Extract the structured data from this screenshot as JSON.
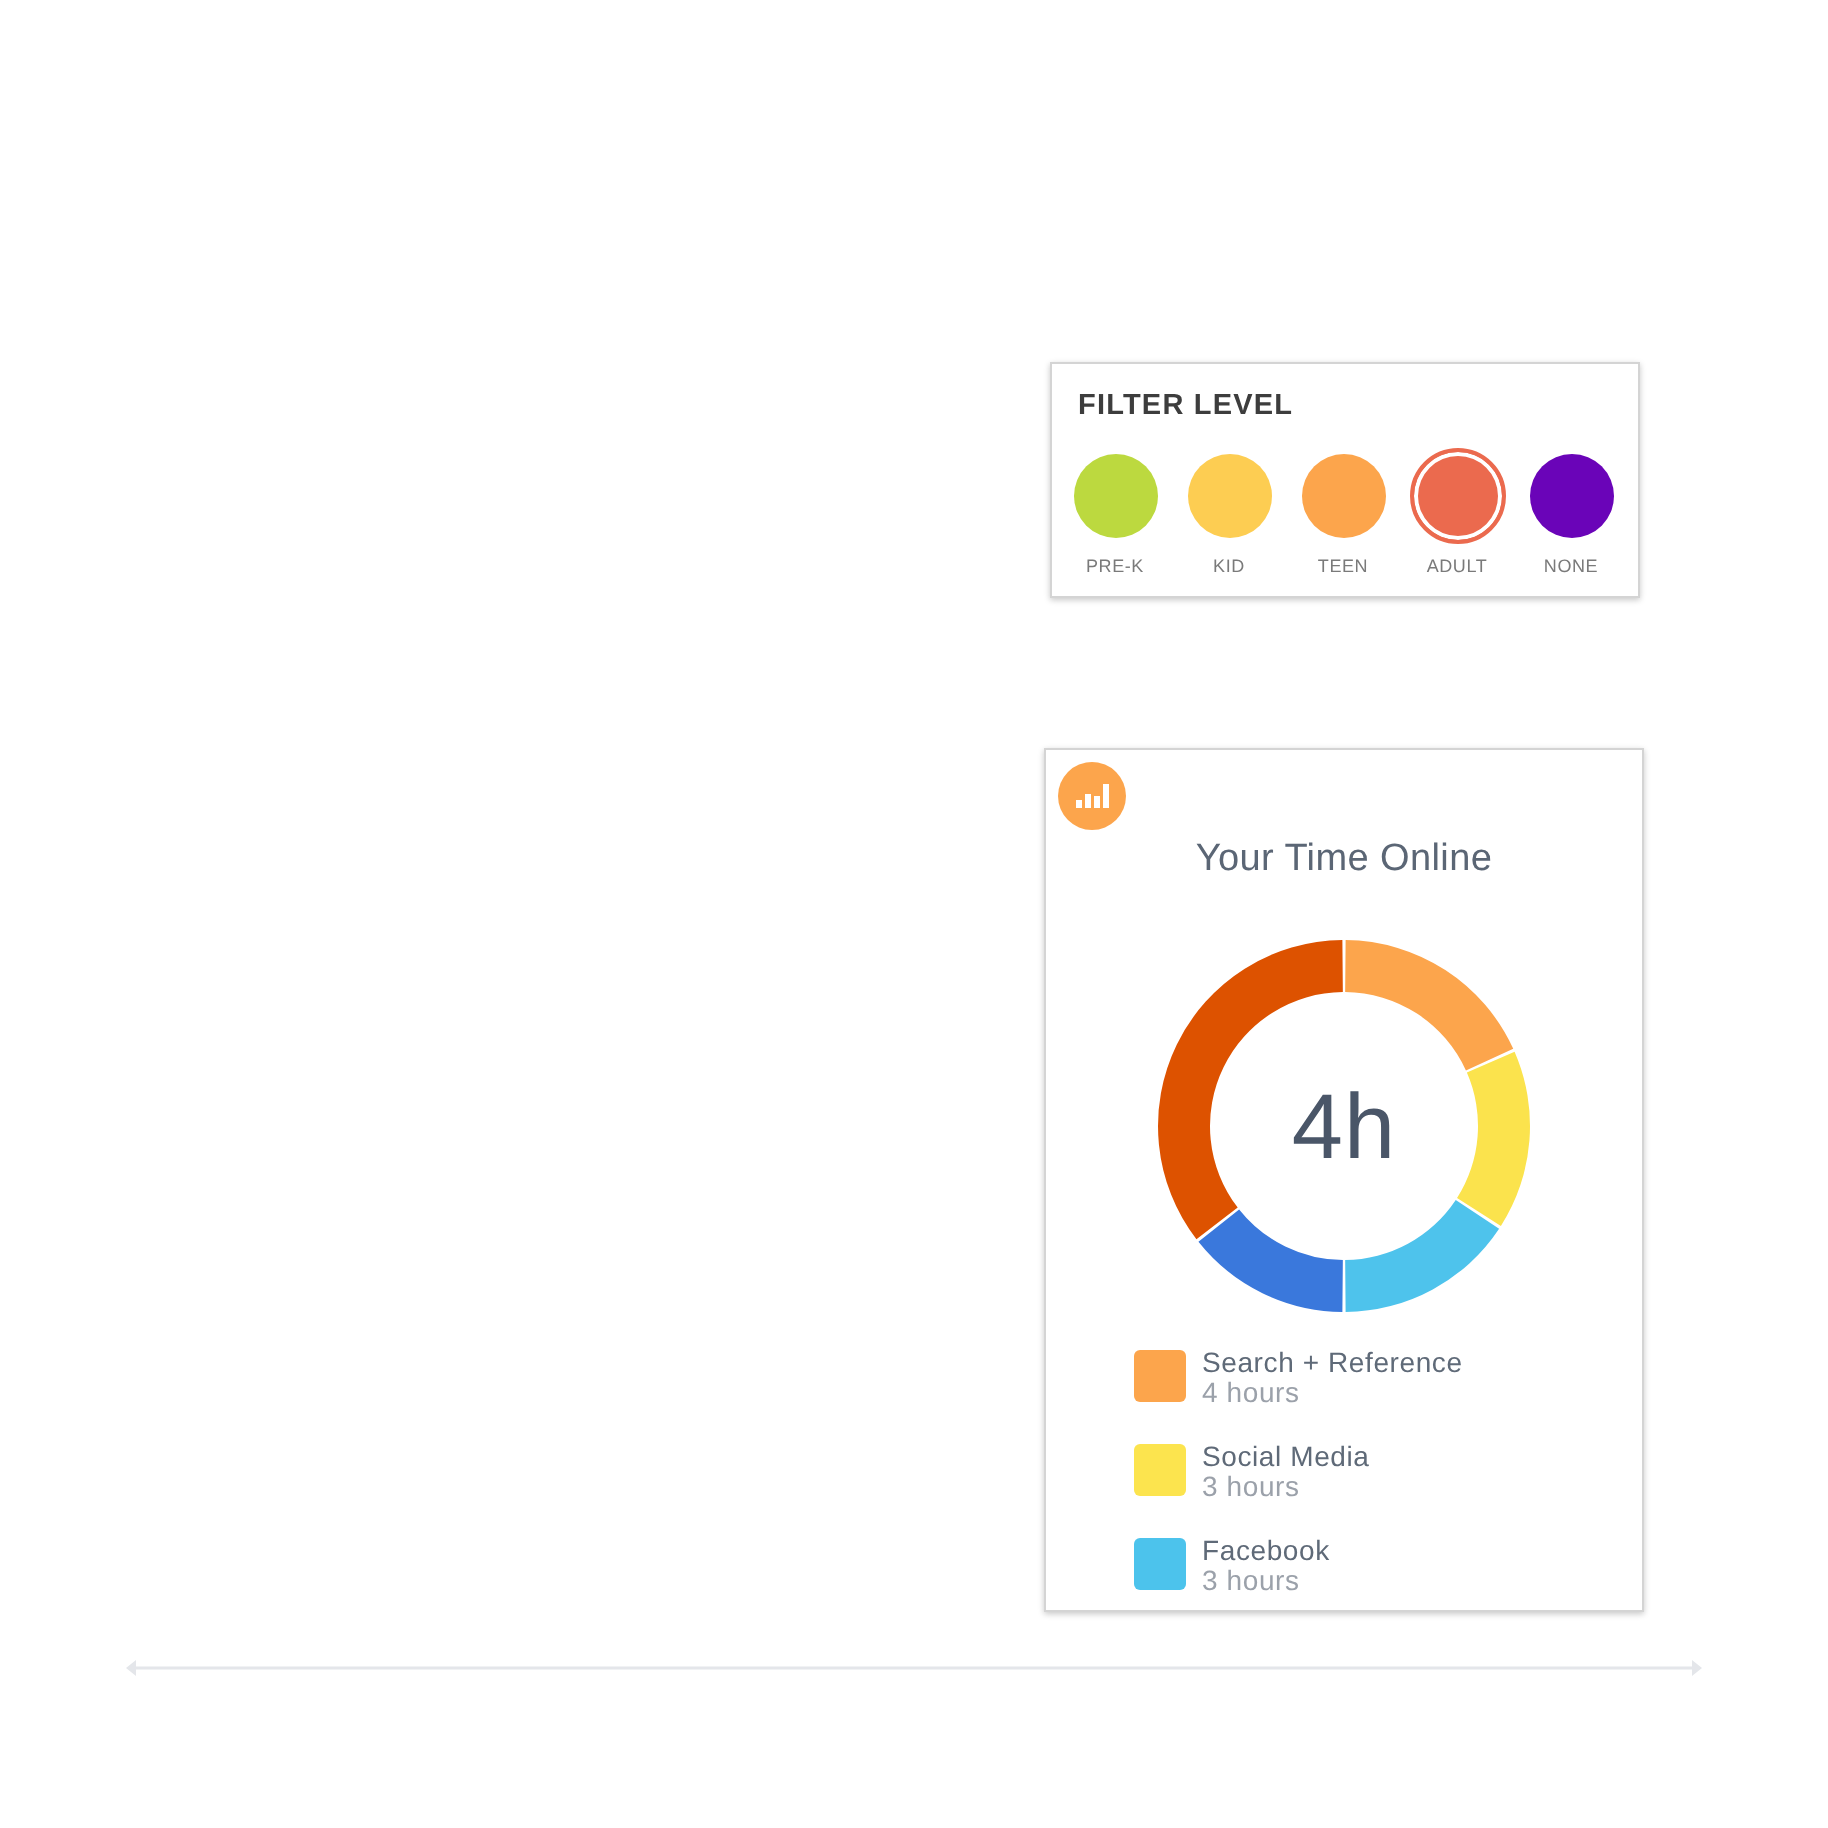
{
  "filter_level": {
    "title": "FILTER LEVEL",
    "levels": [
      {
        "label": "PRE-K",
        "color": "#bcd93f",
        "selected": false
      },
      {
        "label": "KID",
        "color": "#fdcd52",
        "selected": false
      },
      {
        "label": "TEEN",
        "color": "#fca54c",
        "selected": false
      },
      {
        "label": "ADULT",
        "color": "#eb6a4e",
        "selected": true
      },
      {
        "label": "NONE",
        "color": "#6a04b8",
        "selected": false
      }
    ]
  },
  "time_online": {
    "title": "Your Time Online",
    "total": "4h",
    "legend": [
      {
        "name": "Search + Reference",
        "amount": "4 hours",
        "color": "#fca54c"
      },
      {
        "name": "Social Media",
        "amount": "3 hours",
        "color": "#fce44e"
      },
      {
        "name": "Facebook",
        "amount": "3 hours",
        "color": "#4cc3ec"
      }
    ]
  }
}
